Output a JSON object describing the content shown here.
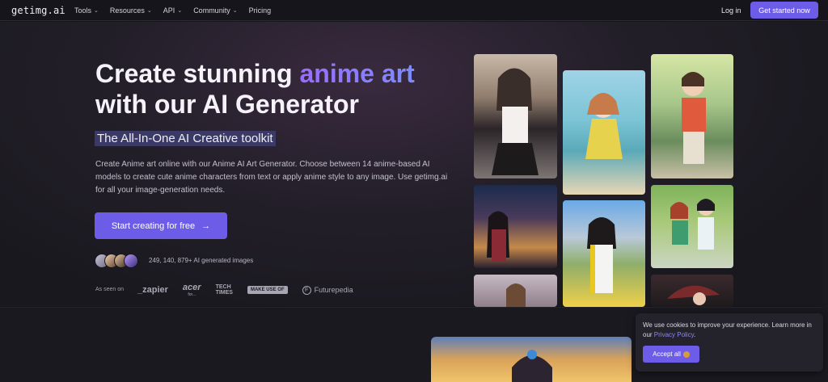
{
  "header": {
    "logo": "getimg.ai",
    "nav": [
      {
        "label": "Tools",
        "has_dropdown": true
      },
      {
        "label": "Resources",
        "has_dropdown": true
      },
      {
        "label": "API",
        "has_dropdown": true
      },
      {
        "label": "Community",
        "has_dropdown": true
      },
      {
        "label": "Pricing",
        "has_dropdown": false
      }
    ],
    "login": "Log in",
    "get_started": "Get started now"
  },
  "hero": {
    "title_part1": "Create stunning ",
    "title_accent": "anime art",
    "title_part2": "with our AI Generator",
    "subtitle": "The All-In-One AI Creative toolkit",
    "description": "Create Anime art online with our Anime AI Art Generator. Choose between 14 anime-based AI models to create cute anime characters from text or apply anime style to any image. Use getimg.ai for all your image-generation needs.",
    "cta": "Start creating for free",
    "cta_icon": "arrow-right-icon",
    "generated_count": "249, 140, 879+ AI generated images",
    "as_seen_on": "As seen on",
    "press": {
      "zapier": "_zapier",
      "acer": "acer",
      "acer_sub": "for...",
      "techtimes_1": "TECH",
      "techtimes_2": "TIMES",
      "makeuseof": "MAKE USE OF",
      "futurepedia": "Futurepedia",
      "futurepedia_icon": "F"
    }
  },
  "cookie": {
    "text": "We use cookies to improve your experience. Learn more in our ",
    "link": "Privacy Policy",
    "text_end": ".",
    "button": "Accept all",
    "button_icon": "cookie-icon"
  },
  "colors": {
    "accent": "#6c5ce7",
    "background": "#17161c"
  }
}
